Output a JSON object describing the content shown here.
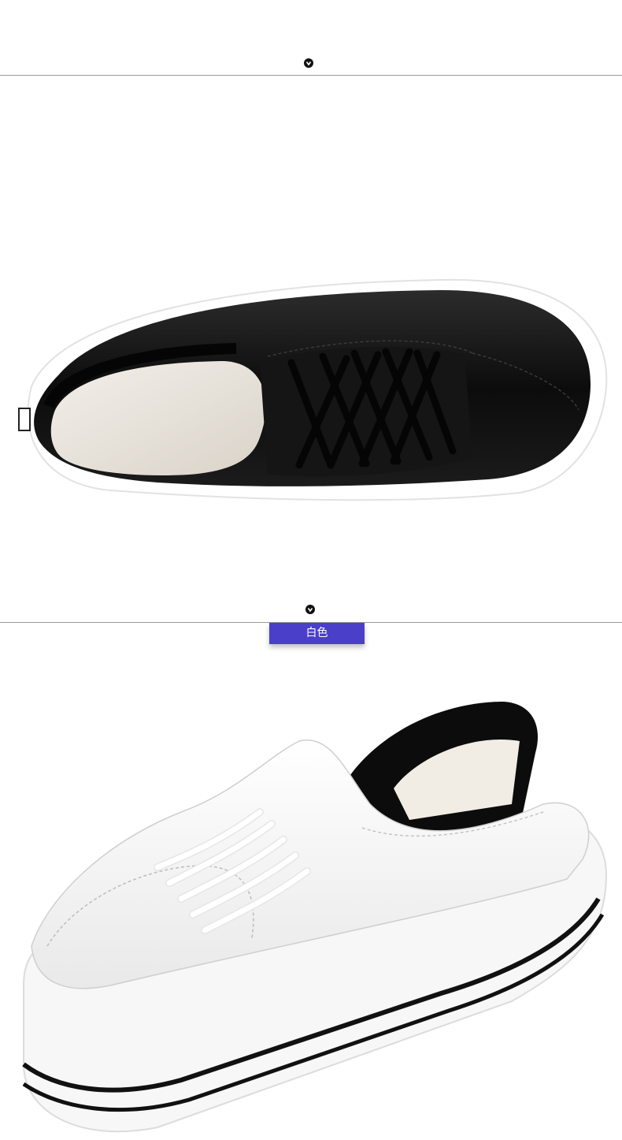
{
  "section_top": {
    "marker_icon": "chevron-down-icon"
  },
  "section_white": {
    "marker_icon": "chevron-down-icon",
    "color_label": "白色",
    "label_color": "#4a3fc8"
  },
  "products": [
    {
      "name": "black-sneaker-top-view",
      "upper_color": "#0f0f0f",
      "sole_color": "#ffffff"
    },
    {
      "name": "white-sneaker-side-view",
      "upper_color": "#f4f4f4",
      "sole_color": "#ffffff",
      "stripe_color": "#111111"
    }
  ]
}
